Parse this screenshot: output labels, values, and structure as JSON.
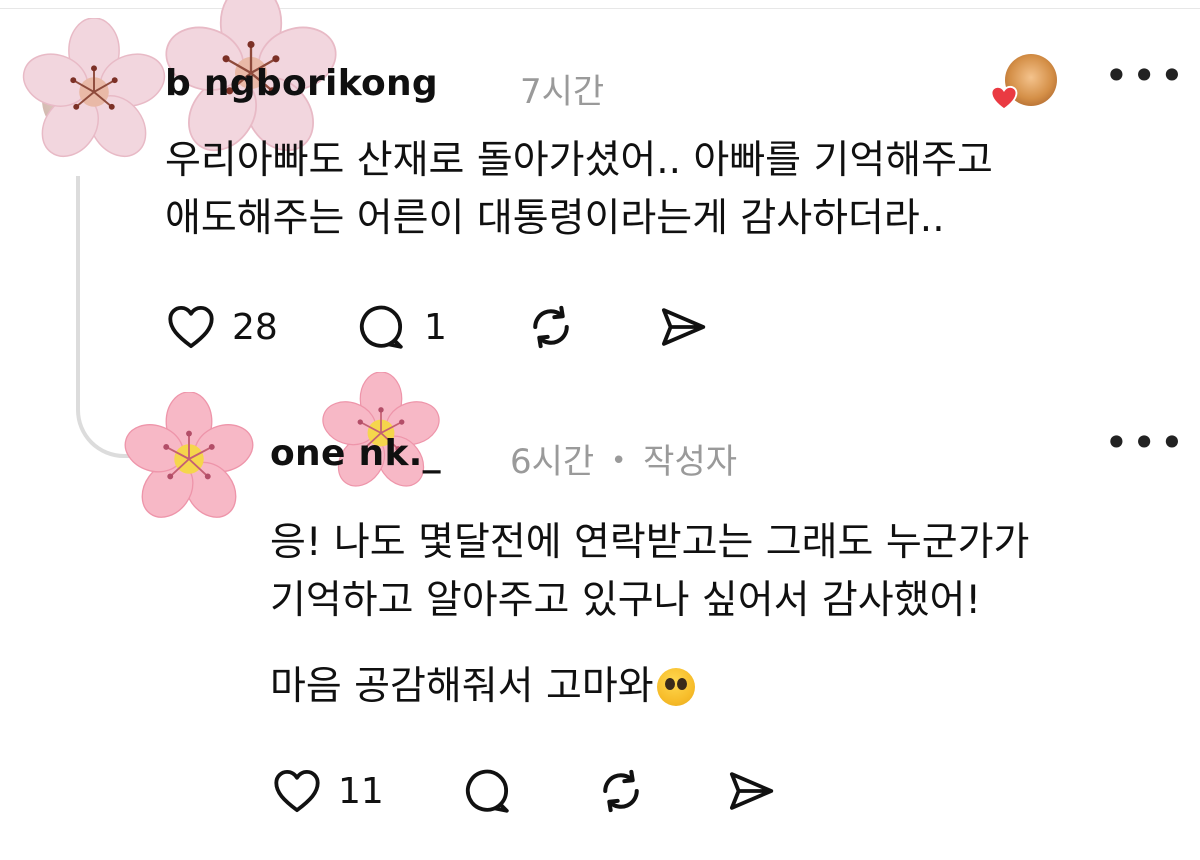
{
  "comments": [
    {
      "username": "b   ngborikong",
      "time": "7시간",
      "text_lines": [
        "우리아빠도 산재로 돌아가셨어.. 아빠를 기억해주고",
        "애도해주는 어른이 대통령이라는게 감사하더라.."
      ],
      "likes": "28",
      "replies": "1"
    },
    {
      "username": "one   nk._",
      "time": "6시간",
      "separator": "•",
      "author_badge": "작성자",
      "text_lines": [
        "응! 나도 몇달전에 연락받고는 그래도 누군가가",
        "기억하고 알아주고 있구나 싶어서 감사했어!"
      ],
      "closing_text": "마음 공감해줘서 고마와",
      "likes": "11"
    }
  ],
  "icons": {
    "like": "heart-icon",
    "reply": "comment-bubble-icon",
    "repost": "repost-icon",
    "share": "share-icon",
    "menu": "more-dots-icon",
    "decoration": "cherry-blossom"
  },
  "colors": {
    "text": "#101010",
    "muted": "#9a9a9a",
    "thread_line": "#dcdcdc",
    "blossom_pink": "#f7b8c6",
    "heart_red": "#ea3a42"
  }
}
